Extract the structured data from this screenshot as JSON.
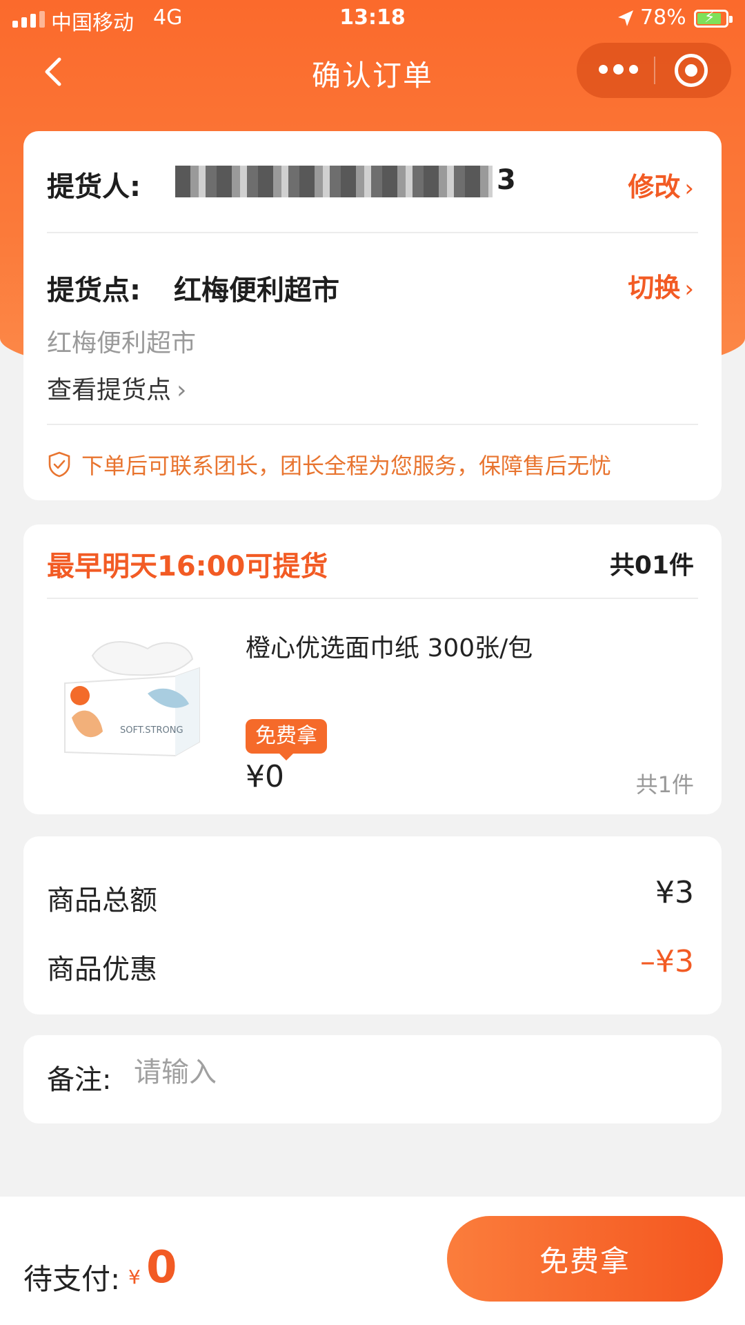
{
  "status_bar": {
    "carrier": "中国移动",
    "network": "4G",
    "time": "13:18",
    "battery": "78%"
  },
  "nav": {
    "title": "确认订单",
    "back_icon": "chevron-left-icon",
    "more_icon": "more-dots-icon",
    "close_icon": "target-circle-icon"
  },
  "pickup_card": {
    "picker_label": "提货人:",
    "picker_suffix": "3",
    "edit_label": "修改",
    "location_label": "提货点:",
    "location_name": "红梅便利超市",
    "switch_label": "切换",
    "location_subtitle": "红梅便利超市",
    "view_location": "查看提货点",
    "notice": "下单后可联系团长，团长全程为您服务，保障售后无忧"
  },
  "order_card": {
    "pickup_time": "最早明天16:00可提货",
    "total_count": "共01件",
    "product": {
      "name": "橙心优选面巾纸 300张/包",
      "badge": "免费拿",
      "price": "¥0",
      "count": "共1件",
      "image_text": "SOFT.STRONG"
    }
  },
  "summary_card": {
    "total_label": "商品总额",
    "total_value": "¥3",
    "discount_label": "商品优惠",
    "discount_value": "–¥3"
  },
  "note_card": {
    "label": "备注:",
    "placeholder": "请输入"
  },
  "bottom_bar": {
    "pay_label": "待支付:",
    "currency": "¥",
    "amount": "0",
    "button_label": "免费拿"
  },
  "colors": {
    "accent": "#f25b24",
    "header": "#fb6a2c"
  }
}
